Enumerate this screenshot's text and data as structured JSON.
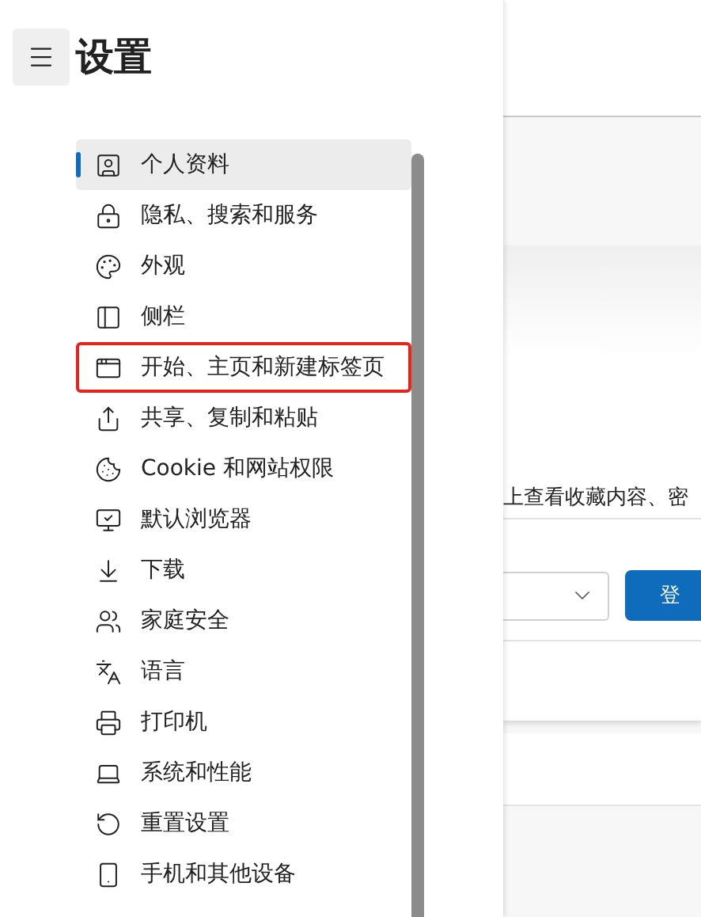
{
  "header": {
    "title": "设置"
  },
  "sidebar": {
    "items": [
      {
        "label": "个人资料",
        "selected": true,
        "highlighted": false
      },
      {
        "label": "隐私、搜索和服务",
        "selected": false,
        "highlighted": false
      },
      {
        "label": "外观",
        "selected": false,
        "highlighted": false
      },
      {
        "label": "侧栏",
        "selected": false,
        "highlighted": false
      },
      {
        "label": "开始、主页和新建标签页",
        "selected": false,
        "highlighted": true
      },
      {
        "label": "共享、复制和粘贴",
        "selected": false,
        "highlighted": false
      },
      {
        "label": "Cookie 和网站权限",
        "selected": false,
        "highlighted": false
      },
      {
        "label": "默认浏览器",
        "selected": false,
        "highlighted": false
      },
      {
        "label": "下载",
        "selected": false,
        "highlighted": false
      },
      {
        "label": "家庭安全",
        "selected": false,
        "highlighted": false
      },
      {
        "label": "语言",
        "selected": false,
        "highlighted": false
      },
      {
        "label": "打印机",
        "selected": false,
        "highlighted": false
      },
      {
        "label": "系统和性能",
        "selected": false,
        "highlighted": false
      },
      {
        "label": "重置设置",
        "selected": false,
        "highlighted": false
      },
      {
        "label": "手机和其他设备",
        "selected": false,
        "highlighted": false
      }
    ]
  },
  "content": {
    "description": "上查看收藏内容、密",
    "sign_in_button": "登"
  }
}
